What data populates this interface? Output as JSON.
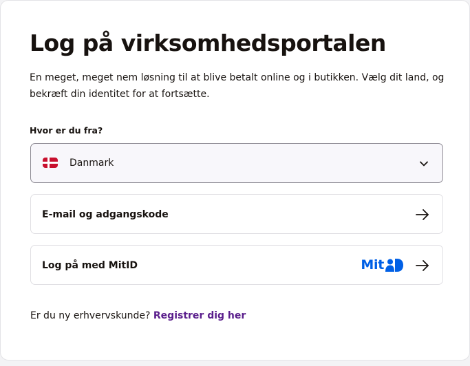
{
  "page": {
    "title": "Log på virksomhedsportalen",
    "description": "En meget, meget nem løsning til at blive betalt online og i butikken. Vælg dit land, og bekræft din identitet for at fortsætte."
  },
  "country": {
    "label": "Hvor er du fra?",
    "selected": "Danmark",
    "flag_icon": "denmark-flag-icon"
  },
  "options": {
    "email": {
      "label": "E-mail og adgangskode",
      "icon": "arrow-right-icon"
    },
    "mitid": {
      "label": "Log på med MitID",
      "logo_text": "Mit",
      "icon": "arrow-right-icon"
    }
  },
  "footer": {
    "question": "Er du ny erhvervskunde?",
    "link": "Registrer dig her"
  },
  "colors": {
    "link": "#5a1e8c",
    "mitid_blue": "#0060e6",
    "text": "#17120f",
    "flag_red": "#c8102e"
  }
}
